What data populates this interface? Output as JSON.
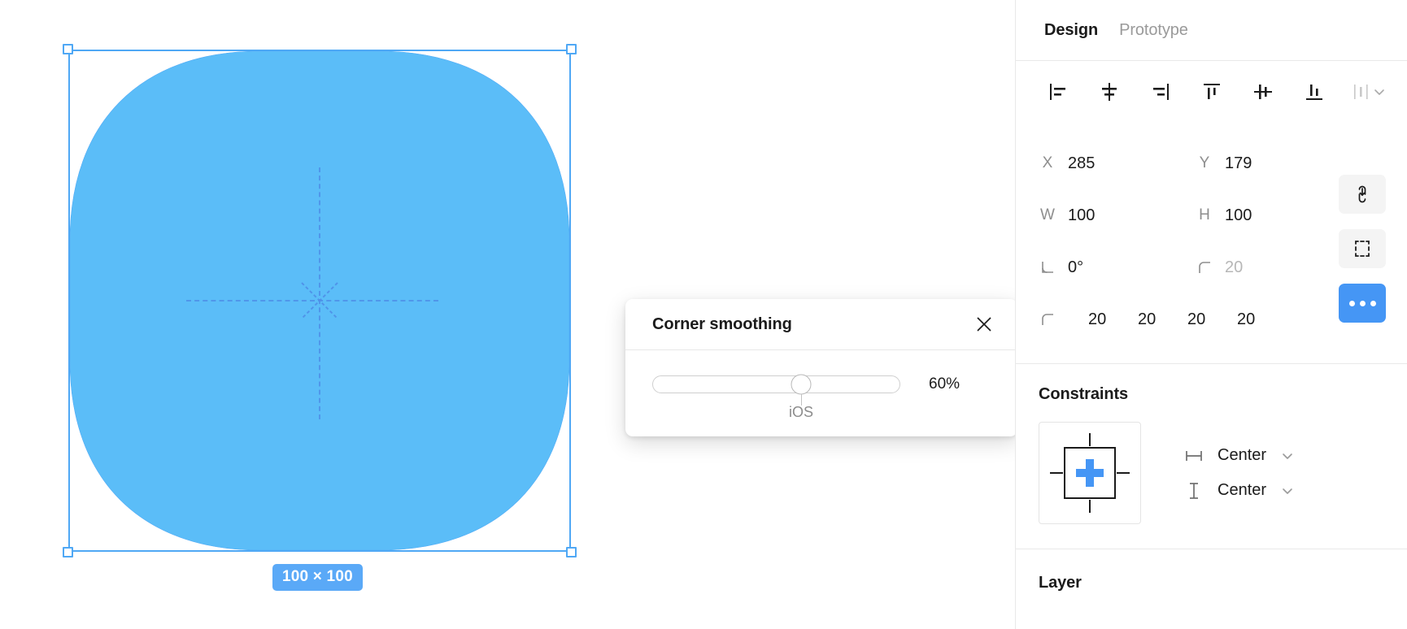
{
  "canvas": {
    "shape": {
      "name": "rounded-rectangle",
      "fill": "#5bbdf8",
      "stroke": "#4fa8f5",
      "size_badge": "100 × 100"
    },
    "selection": {
      "handles": [
        "top-left",
        "top-right",
        "bottom-left",
        "bottom-right"
      ],
      "color": "#4fa8f5"
    },
    "guides": {
      "color": "#4f90e8",
      "style": "dashed-crosshair-with-star"
    }
  },
  "popover": {
    "title": "Corner smoothing",
    "close_label": "×",
    "slider": {
      "value_percent": 60,
      "value_label": "60%",
      "tick_label": "iOS",
      "min": 0,
      "max": 100
    }
  },
  "panel": {
    "tabs": [
      {
        "label": "Design",
        "active": true
      },
      {
        "label": "Prototype",
        "active": false
      }
    ],
    "align_buttons": [
      {
        "name": "align-left",
        "title": "Align left"
      },
      {
        "name": "align-horizontal-centers",
        "title": "Align horizontal centers"
      },
      {
        "name": "align-right",
        "title": "Align right"
      },
      {
        "name": "align-top",
        "title": "Align top"
      },
      {
        "name": "align-vertical-centers",
        "title": "Align vertical centers"
      },
      {
        "name": "align-bottom",
        "title": "Align bottom"
      }
    ],
    "align_more": {
      "name": "distribute-menu",
      "title": "Tidy up"
    },
    "properties": {
      "x": {
        "label": "X",
        "value": "285"
      },
      "y": {
        "label": "Y",
        "value": "179"
      },
      "w": {
        "label": "W",
        "value": "100"
      },
      "h": {
        "label": "H",
        "value": "100"
      },
      "rotation": {
        "label": "angle",
        "value": "0°"
      },
      "corner_radius": {
        "label": "corner-radius",
        "value": "20",
        "muted": true
      },
      "individual_corners": {
        "top_left": "20",
        "top_right": "20",
        "bottom_right": "20",
        "bottom_left": "20"
      }
    },
    "side_buttons": [
      {
        "name": "constrain-proportions",
        "active": false
      },
      {
        "name": "resize-to-fit",
        "active": false
      },
      {
        "name": "more-options",
        "active": true,
        "color": "#4596f5"
      }
    ],
    "constraints": {
      "title": "Constraints",
      "horizontal": {
        "label": "Center",
        "icon": "horizontal-constraint-icon"
      },
      "vertical": {
        "label": "Center",
        "icon": "vertical-constraint-icon"
      },
      "widget_accent": "#4596f5"
    },
    "layer": {
      "title": "Layer"
    }
  }
}
